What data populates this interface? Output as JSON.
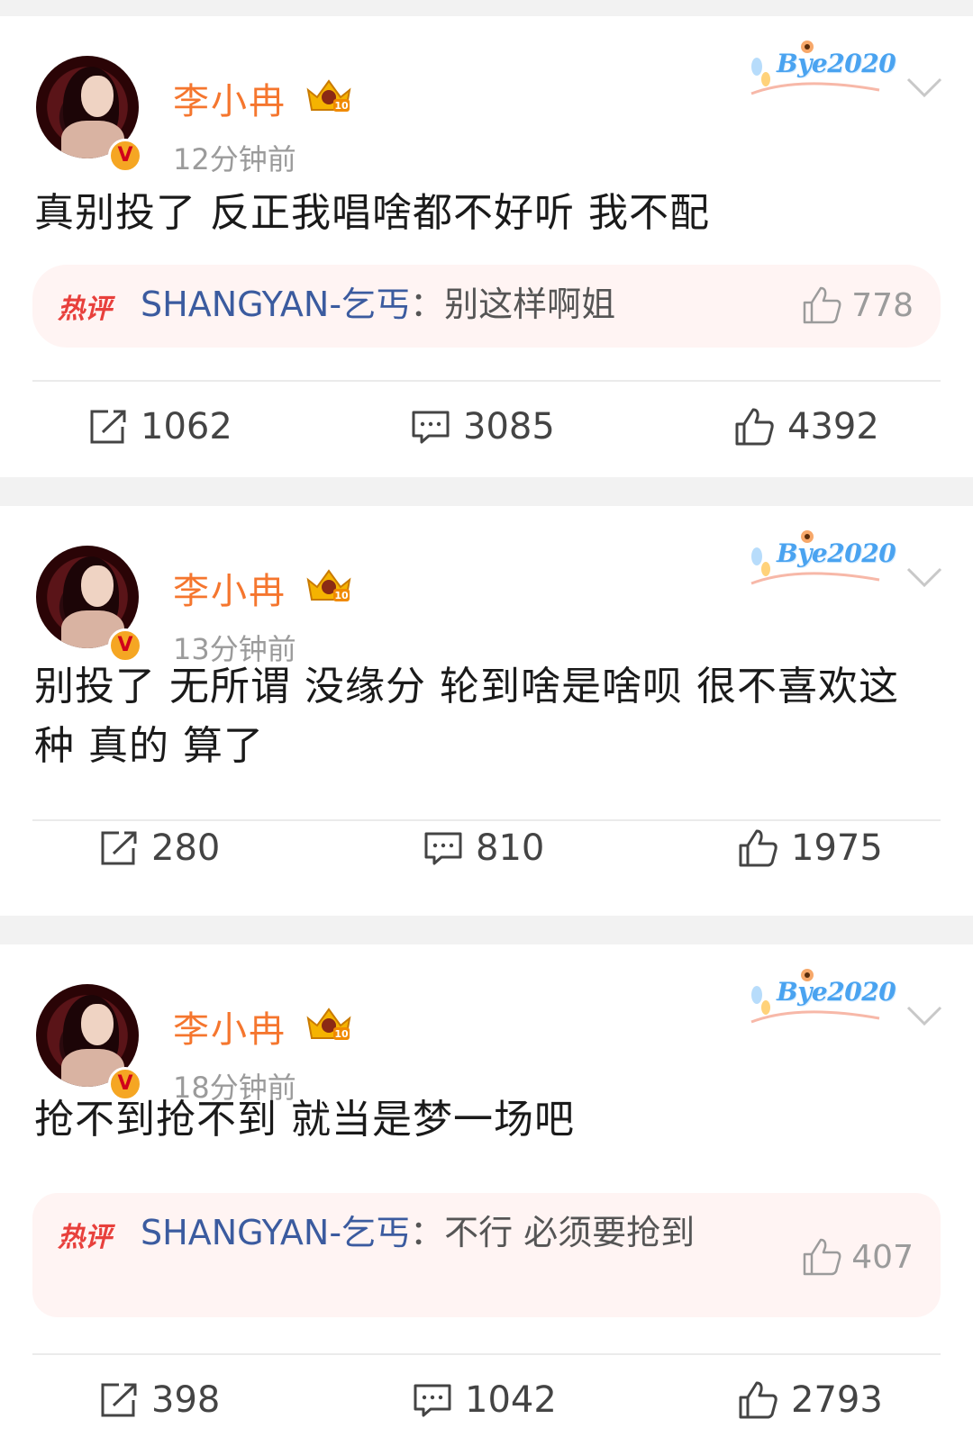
{
  "posts": [
    {
      "username": "李小冉",
      "verified_badge": "V",
      "level_badge": "crown-10-icon",
      "decoration_text": "Bye2020",
      "time": "12分钟前",
      "text": "真别投了 反正我唱啥都不好听 我不配",
      "hot_comment": {
        "label": "热评",
        "user": "SHANGYAN-乞丐",
        "separator": "：",
        "text": "别这样啊姐",
        "likes": "778"
      },
      "reposts": "1062",
      "comments": "3085",
      "likes": "4392"
    },
    {
      "username": "李小冉",
      "verified_badge": "V",
      "level_badge": "crown-10-icon",
      "decoration_text": "Bye2020",
      "time": "13分钟前",
      "text": "别投了 无所谓 没缘分 轮到啥是啥呗 很不喜欢这种 真的  算了",
      "hot_comment": null,
      "reposts": "280",
      "comments": "810",
      "likes": "1975"
    },
    {
      "username": "李小冉",
      "verified_badge": "V",
      "level_badge": "crown-10-icon",
      "decoration_text": "Bye2020",
      "time": "18分钟前",
      "text": "抢不到抢不到 就当是梦一场吧",
      "hot_comment": {
        "label": "热评",
        "user": "SHANGYAN-乞丐",
        "separator": "：",
        "text": "不行 必须要抢到",
        "likes": "407"
      },
      "reposts": "398",
      "comments": "1042",
      "likes": "2793"
    }
  ],
  "colors": {
    "username": "#f5762e",
    "hot_label": "#e8403c",
    "hot_user": "#3b5b9f",
    "hot_bg": "#fff4f3",
    "page_bg": "#f2f2f2"
  }
}
